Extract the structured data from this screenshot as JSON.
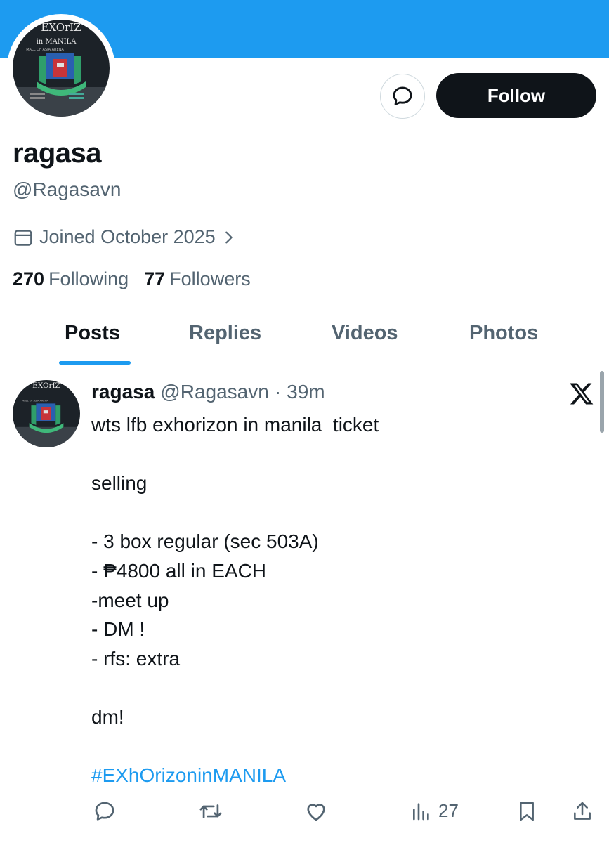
{
  "profile": {
    "display_name": "ragasa",
    "handle": "@Ragasavn",
    "joined": "Joined October 2025",
    "following_count": "270",
    "following_label": "Following",
    "followers_count": "77",
    "followers_label": "Followers"
  },
  "avatar_text": {
    "top": "EXOrIZ",
    "subtitle": "in MANILA",
    "venue": "MALL OF ASIA ARENA",
    "stage": "STAGE"
  },
  "buttons": {
    "follow": "Follow"
  },
  "tabs": [
    {
      "label": "Posts",
      "active": true
    },
    {
      "label": "Replies",
      "active": false
    },
    {
      "label": "Videos",
      "active": false
    },
    {
      "label": "Photos",
      "active": false
    }
  ],
  "post": {
    "name": "ragasa",
    "handle": "@Ragasavn",
    "separator": "·",
    "time": "39m",
    "lines": [
      "wts lfb exhorizon in manila  ticket",
      "",
      "selling",
      "",
      "- 3 box regular (sec 503A)",
      "- ₱4800 all in EACH",
      "-meet up",
      "- DM !",
      "- rfs: extra",
      "",
      "dm!",
      ""
    ],
    "hashtag": "#EXhOrizoninMANILA",
    "views": "27"
  },
  "colors": {
    "banner": "#1d9bf0",
    "accent": "#1d9bf0",
    "text_primary": "#0f1419",
    "text_secondary": "#536471"
  },
  "icons": [
    "message-icon",
    "calendar-icon",
    "chevron-right-icon",
    "x-logo-icon",
    "reply-icon",
    "retweet-icon",
    "like-icon",
    "views-icon",
    "bookmark-icon",
    "share-icon"
  ]
}
